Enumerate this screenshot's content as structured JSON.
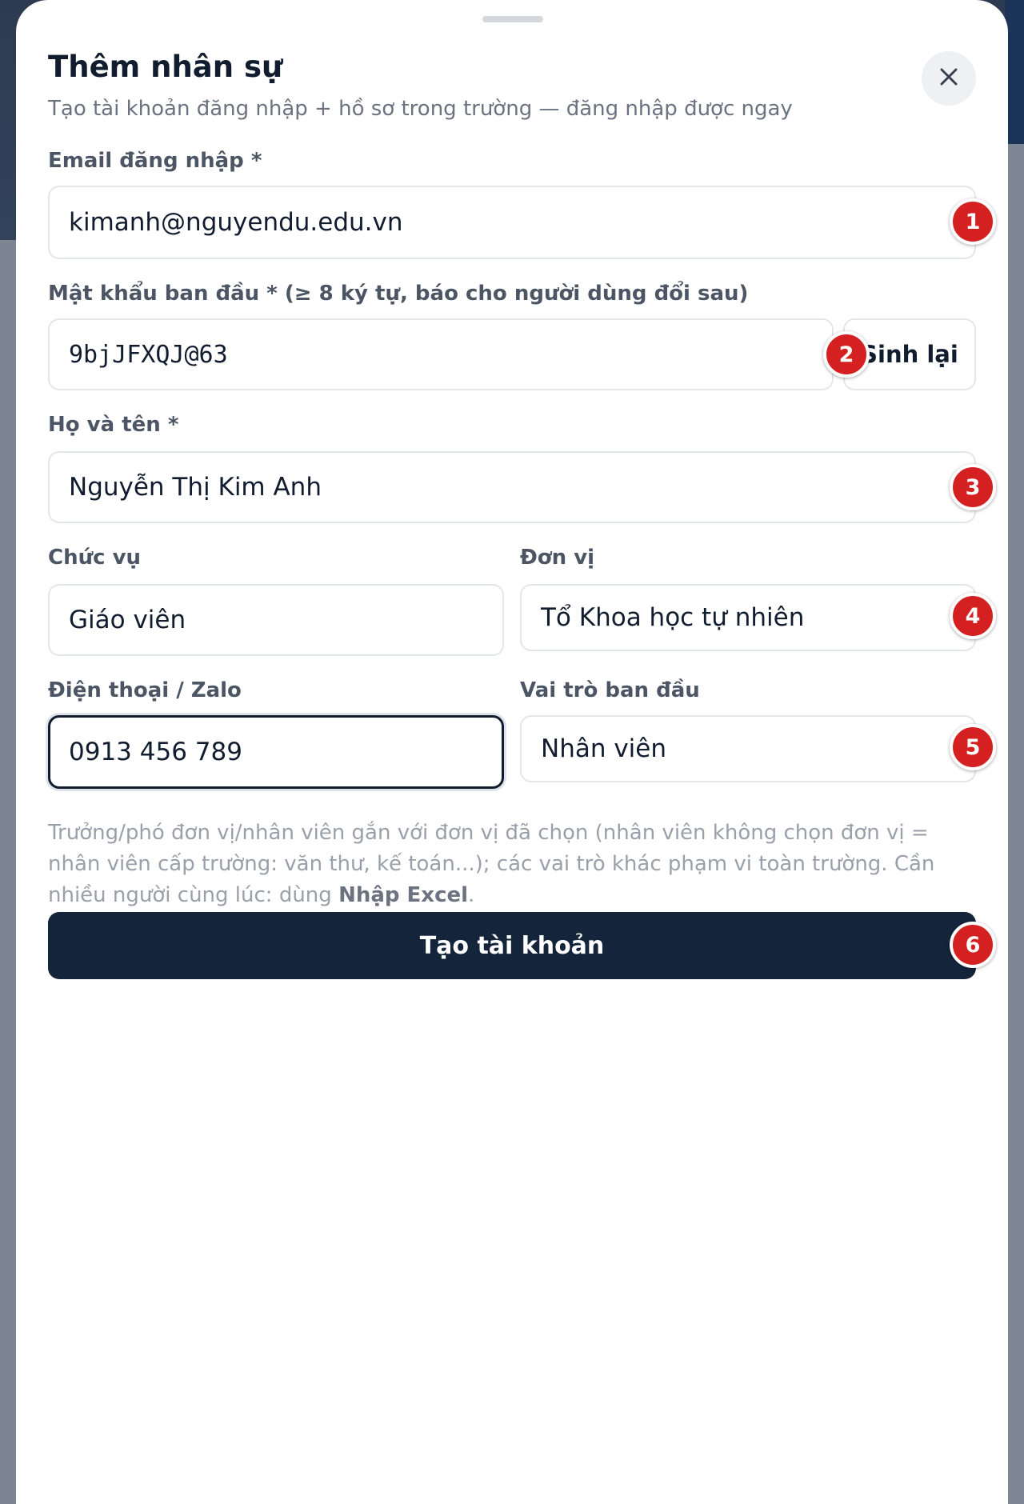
{
  "dialog": {
    "title": "Thêm nhân sự",
    "subtitle": "Tạo tài khoản đăng nhập + hồ sơ trong trường — đăng nhập được ngay",
    "close_icon": "close-icon"
  },
  "form": {
    "email": {
      "label": "Email đăng nhập *",
      "value": "kimanh@nguyendu.edu.vn"
    },
    "password": {
      "label": "Mật khẩu ban đầu * (≥ 8 ký tự, báo cho người dùng đổi sau)",
      "value": "9bjJFXQJ@63",
      "regenerate_label": "Sinh lại"
    },
    "full_name": {
      "label": "Họ và tên *",
      "value": "Nguyễn Thị Kim Anh"
    },
    "position": {
      "label": "Chức vụ",
      "value": "Giáo viên"
    },
    "unit": {
      "label": "Đơn vị",
      "value": "Tổ Khoa học tự nhiên"
    },
    "phone": {
      "label": "Điện thoại / Zalo",
      "value": "0913 456 789"
    },
    "initial_role": {
      "label": "Vai trò ban đầu",
      "value": "Nhân viên"
    },
    "hint": {
      "text": "Trưởng/phó đơn vị/nhân viên gắn với đơn vị đã chọn (nhân viên không chọn đơn vị = nhân viên cấp trường: văn thư, kế toán...); các vai trò khác phạm vi toàn trường. Cần nhiều người cùng lúc: dùng ",
      "link": "Nhập Excel",
      "end": "."
    },
    "submit_label": "Tạo tài khoản"
  },
  "badges": [
    "1",
    "2",
    "3",
    "4",
    "5",
    "6"
  ],
  "colors": {
    "primary": "#14243b",
    "badge": "#d42020",
    "border": "#e3e6eb"
  }
}
